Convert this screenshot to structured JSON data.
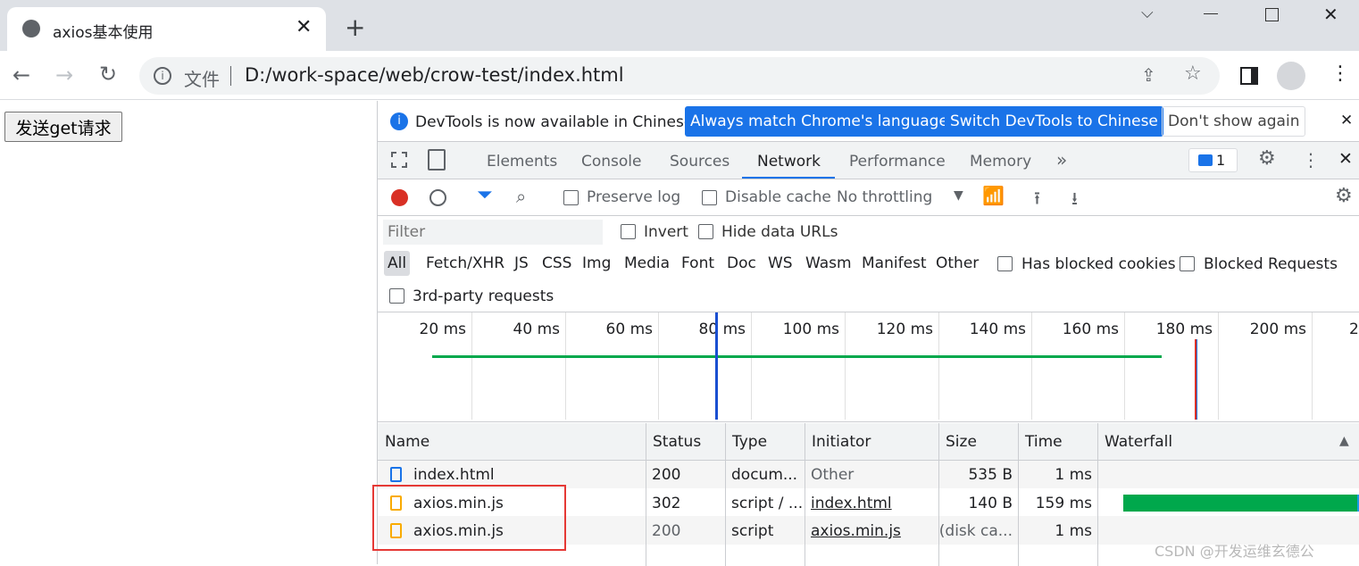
{
  "browser": {
    "tab_title": "axios基本使用",
    "url_prefix": "文件",
    "url": "D:/work-space/web/crow-test/index.html"
  },
  "page": {
    "button_label": "发送get请求"
  },
  "infobar": {
    "message": "DevTools is now available in Chinese!",
    "btn_match": "Always match Chrome's language",
    "btn_switch": "Switch DevTools to Chinese",
    "btn_dismiss": "Don't show again"
  },
  "devtools_tabs": [
    "Elements",
    "Console",
    "Sources",
    "Network",
    "Performance",
    "Memory"
  ],
  "active_tab": "Network",
  "issues_count": "1",
  "network_toolbar": {
    "preserve_log": "Preserve log",
    "disable_cache": "Disable cache",
    "throttling": "No throttling"
  },
  "filter": {
    "placeholder": "Filter",
    "invert": "Invert",
    "hide_data_urls": "Hide data URLs"
  },
  "type_filters": [
    "All",
    "Fetch/XHR",
    "JS",
    "CSS",
    "Img",
    "Media",
    "Font",
    "Doc",
    "WS",
    "Wasm",
    "Manifest",
    "Other"
  ],
  "blocked_cookies": "Has blocked cookies",
  "blocked_requests": "Blocked Requests",
  "third_party": "3rd-party requests",
  "timeline_ticks": [
    "20 ms",
    "40 ms",
    "60 ms",
    "80 ms",
    "100 ms",
    "120 ms",
    "140 ms",
    "160 ms",
    "180 ms",
    "200 ms",
    "2"
  ],
  "table": {
    "headers": [
      "Name",
      "Status",
      "Type",
      "Initiator",
      "Size",
      "Time",
      "Waterfall"
    ],
    "rows": [
      [
        "index.html",
        "200",
        "docum...",
        "Other",
        "535 B",
        "1 ms"
      ],
      [
        "axios.min.js",
        "302",
        "script / ...",
        "index.html",
        "140 B",
        "159 ms"
      ],
      [
        "axios.min.js",
        "200",
        "script",
        "axios.min.js",
        "(disk ca...",
        "1 ms"
      ]
    ]
  },
  "watermark": "CSDN @开发运维玄德公",
  "colors": {
    "accent": "#1a73e8",
    "record": "#d93025",
    "waterfall_green": "#00a84c",
    "highlight_box": "#e53935"
  }
}
